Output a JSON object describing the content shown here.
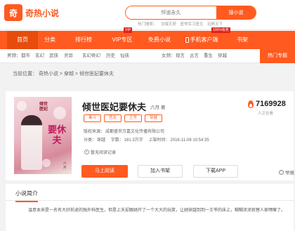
{
  "header": {
    "logo_char": "奇",
    "site_name": "奇热小说",
    "search_placeholder": "怦遥永久",
    "search_button": "搜小说",
    "hot_label": "热门搜索：",
    "hot_items": [
      "龙岷天骄",
      "医常实习医生",
      "玩熊天下"
    ]
  },
  "nav": {
    "items": [
      "首页",
      "分类",
      "排行榜",
      "VIP专区",
      "免费小说",
      "手机客户端",
      "书架"
    ],
    "badges": {
      "vip": "VIP",
      "app": "100%有奖"
    }
  },
  "categories": {
    "male_label": "男频：",
    "male": [
      "都市",
      "玄幻",
      "武侠",
      "灵异",
      "玄幻奇幻",
      "历史",
      "仙侠"
    ],
    "female_label": "女频：",
    "female": [
      "现言",
      "古言",
      "重生",
      "穿越"
    ],
    "hot_button": "热门专题"
  },
  "breadcrumb": {
    "prefix": "当前位置：",
    "site": "奇热小说",
    "category": "穿越",
    "book": "倾世医妃要休夫",
    "sep": ">"
  },
  "book": {
    "title": "倾世医妃要休夫",
    "author": "六月",
    "author_suffix": "著",
    "cover_title": "要休夫",
    "cover_top": "倾世医妃",
    "cover_author": "六月",
    "tags": [
      "毒斗",
      "宫女",
      "王爷",
      "穿越"
    ],
    "copyright_label": "版权来源：",
    "copyright": "成都盛世万嘉文化传播有限公司",
    "category_label": "分类：",
    "category": "穿越",
    "words_label": "字数：",
    "words": "181.3万字",
    "updated_label": "上架时间：",
    "updated": "2016-11-08 10:54:35",
    "old_record": "暂无阅读记录",
    "popularity": "7169928",
    "popularity_label": "人正在看"
  },
  "actions": {
    "read": "马上阅读",
    "shelf": "加入书架",
    "download": "下载APP",
    "report": "举报"
  },
  "intro": {
    "heading": "小说简介",
    "text": "温意本来是一名有大好前途的独外科医生，但是上天却跟她开了一个大大的玩笑，让她穿越到到一王爷的床上，糊糊涂涂就替人家嘿嘛了。"
  },
  "colors": {
    "accent": "#ff5a1f"
  }
}
